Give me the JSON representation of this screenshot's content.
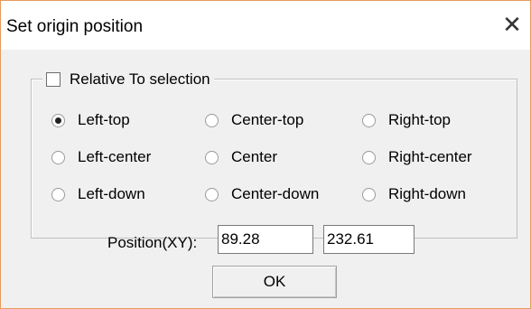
{
  "dialog": {
    "title": "Set origin position",
    "close_glyph": "✕"
  },
  "relative_to_selection": {
    "label": "Relative To selection",
    "checked": false
  },
  "origin_options": [
    {
      "label": "Left-top",
      "selected": true
    },
    {
      "label": "Center-top",
      "selected": false
    },
    {
      "label": "Right-top",
      "selected": false
    },
    {
      "label": "Left-center",
      "selected": false
    },
    {
      "label": "Center",
      "selected": false
    },
    {
      "label": "Right-center",
      "selected": false
    },
    {
      "label": "Left-down",
      "selected": false
    },
    {
      "label": "Center-down",
      "selected": false
    },
    {
      "label": "Right-down",
      "selected": false
    }
  ],
  "position": {
    "label": "Position(XY):",
    "x": "89.28",
    "y": "232.61"
  },
  "ok_label": "OK",
  "colors": {
    "window_border": "#e79b5c",
    "dialog_bg": "#f0f0f0"
  }
}
